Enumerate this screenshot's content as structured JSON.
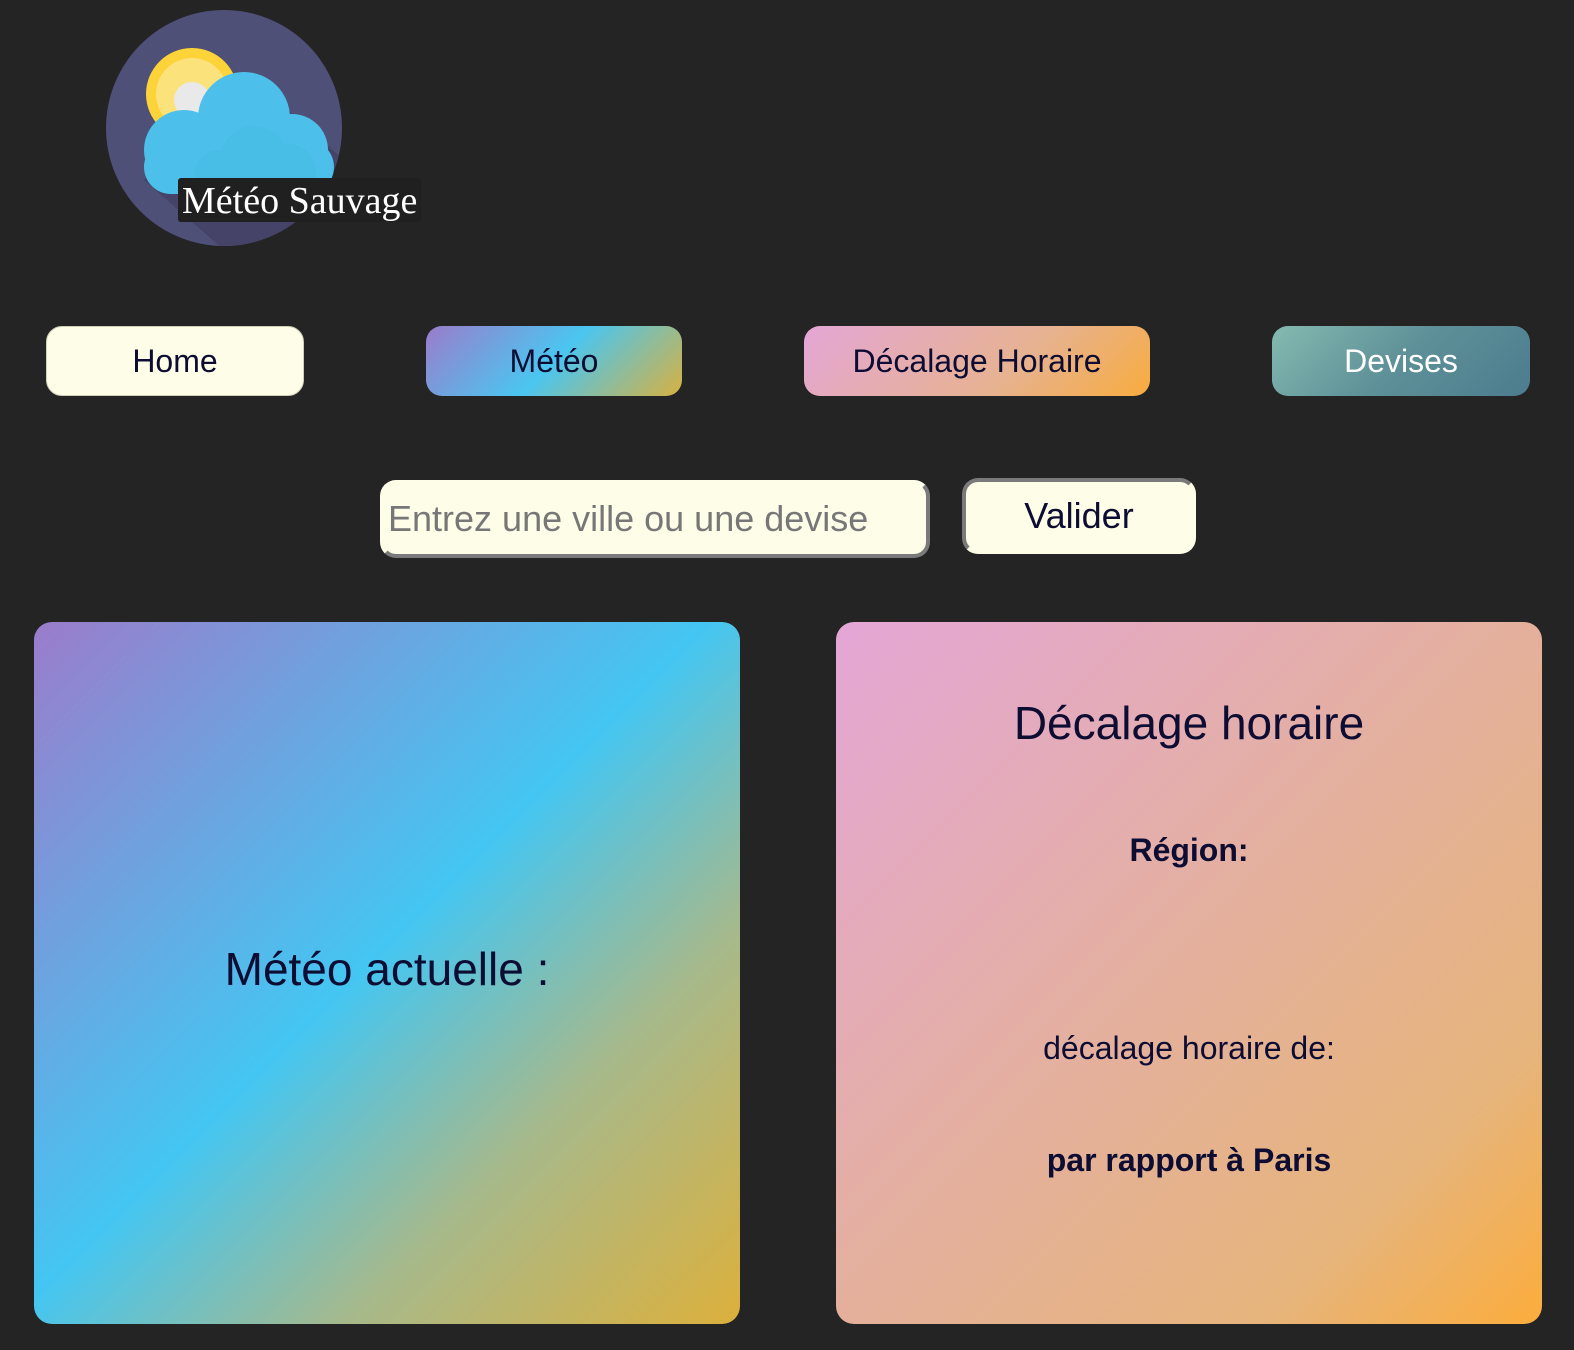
{
  "brand": {
    "logo_text": "Météo Sauvage",
    "logo_icon": "sun-cloud-icon"
  },
  "nav": {
    "home_label": "Home",
    "meteo_label": "Météo",
    "decalage_label": "Décalage Horaire",
    "devises_label": "Devises"
  },
  "search": {
    "placeholder": "Entrez une ville ou une devise",
    "value": "",
    "submit_label": "Valider"
  },
  "meteo_card": {
    "title": "Météo actuelle :"
  },
  "decalage_card": {
    "title": "Décalage horaire",
    "region_label": "Région:",
    "offset_label": "décalage horaire de:",
    "reference_label": "par rapport à Paris"
  },
  "colors": {
    "background": "#242424",
    "button_light": "#fdfde8",
    "text_dark": "#0d0d33"
  }
}
